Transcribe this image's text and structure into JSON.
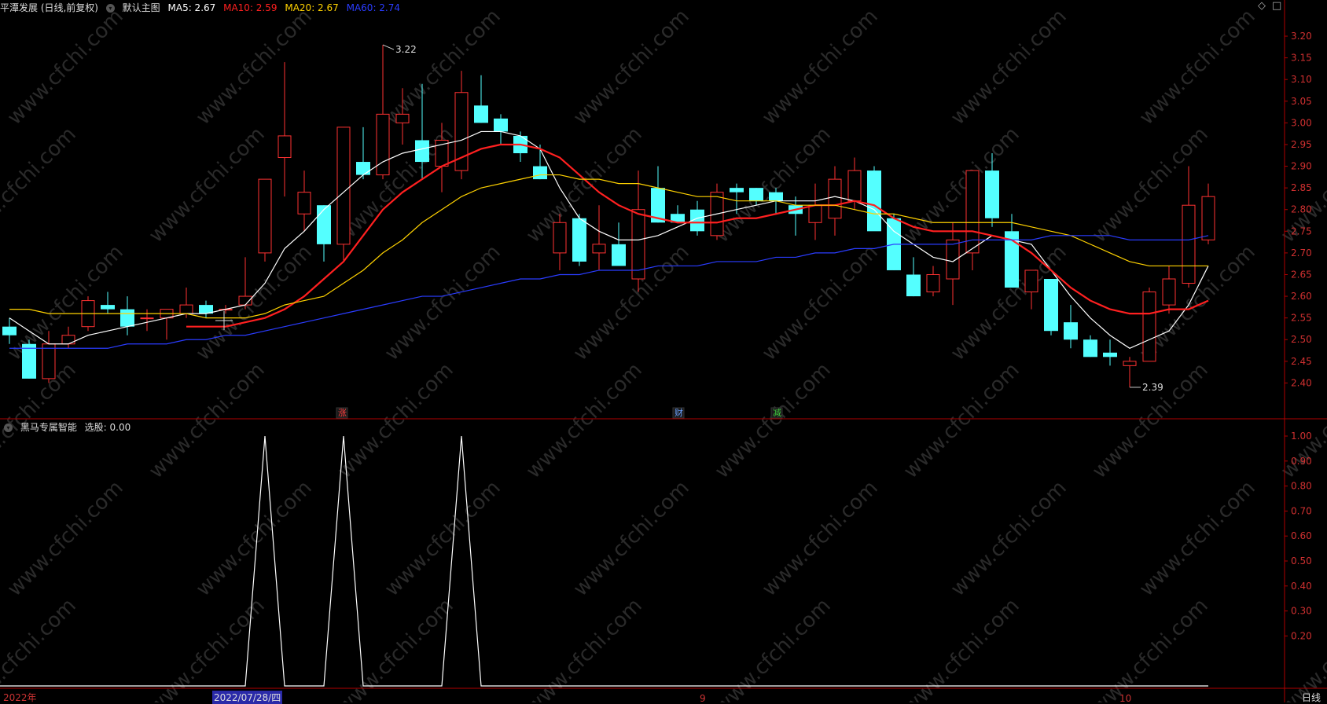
{
  "header": {
    "stock_label": "平潭发展 (日线,前复权)",
    "main_chart_label": "默认主图",
    "ma_items": [
      {
        "label": "MA5: 2.67",
        "color": "#ffffff"
      },
      {
        "label": "MA10: 2.59",
        "color": "#ff2020"
      },
      {
        "label": "MA20: 2.67",
        "color": "#ffd200"
      },
      {
        "label": "MA60: 2.74",
        "color": "#2a3cff"
      }
    ]
  },
  "subchart": {
    "label": "黑马专属智能",
    "value_label": "选股: 0.00"
  },
  "period_label": "日线",
  "x_labels": [
    "2022年",
    "2022/07/28/四",
    "9",
    "10"
  ],
  "markers": {
    "high": "3.22",
    "low": "2.39",
    "tags": [
      "涨",
      "财",
      "减"
    ]
  },
  "watermark": "www.cfchi.com",
  "chart_data": {
    "type": "candlestick",
    "price_axis": {
      "min": 2.35,
      "max": 3.22,
      "ticks": [
        "3.20",
        "3.15",
        "3.10",
        "3.05",
        "3.00",
        "2.95",
        "2.90",
        "2.85",
        "2.80",
        "2.75",
        "2.70",
        "2.65",
        "2.60",
        "2.55",
        "2.50",
        "2.45",
        "2.40"
      ]
    },
    "indicator_axis": {
      "min": 0,
      "max": 1.0,
      "ticks": [
        "1.00",
        "0.90",
        "0.80",
        "0.70",
        "0.60",
        "0.50",
        "0.40",
        "0.30",
        "0.20"
      ]
    },
    "colors": {
      "up": "#ff3232",
      "down": "#54ffff",
      "axis": "#b00000",
      "tick_text": "#d03030"
    },
    "candles": [
      [
        2.53,
        2.55,
        2.49,
        2.51
      ],
      [
        2.49,
        2.5,
        2.41,
        2.41
      ],
      [
        2.41,
        2.52,
        2.4,
        2.49
      ],
      [
        2.49,
        2.53,
        2.48,
        2.51
      ],
      [
        2.53,
        2.6,
        2.52,
        2.59
      ],
      [
        2.58,
        2.61,
        2.56,
        2.57
      ],
      [
        2.57,
        2.6,
        2.51,
        2.53
      ],
      [
        2.55,
        2.57,
        2.52,
        2.55
      ],
      [
        2.55,
        2.57,
        2.5,
        2.57
      ],
      [
        2.56,
        2.62,
        2.55,
        2.58
      ],
      [
        2.58,
        2.59,
        2.55,
        2.56
      ],
      [
        2.57,
        2.58,
        2.56,
        2.57
      ],
      [
        2.58,
        2.69,
        2.57,
        2.6
      ],
      [
        2.7,
        2.87,
        2.68,
        2.87
      ],
      [
        2.92,
        3.14,
        2.83,
        2.97
      ],
      [
        2.79,
        2.89,
        2.75,
        2.84
      ],
      [
        2.81,
        2.81,
        2.68,
        2.72
      ],
      [
        2.72,
        2.99,
        2.68,
        2.99
      ],
      [
        2.91,
        2.99,
        2.87,
        2.88
      ],
      [
        2.88,
        3.18,
        2.87,
        3.02
      ],
      [
        3.0,
        3.08,
        2.95,
        3.02
      ],
      [
        2.96,
        3.09,
        2.87,
        2.91
      ],
      [
        2.9,
        3.0,
        2.84,
        2.96
      ],
      [
        2.89,
        3.12,
        2.87,
        3.07
      ],
      [
        3.04,
        3.11,
        3.0,
        3.0
      ],
      [
        3.01,
        3.02,
        2.95,
        2.98
      ],
      [
        2.97,
        2.98,
        2.91,
        2.93
      ],
      [
        2.9,
        2.95,
        2.87,
        2.87
      ],
      [
        2.7,
        2.79,
        2.66,
        2.77
      ],
      [
        2.78,
        2.79,
        2.67,
        2.68
      ],
      [
        2.7,
        2.81,
        2.66,
        2.72
      ],
      [
        2.72,
        2.77,
        2.68,
        2.67
      ],
      [
        2.64,
        2.89,
        2.61,
        2.8
      ],
      [
        2.85,
        2.9,
        2.77,
        2.77
      ],
      [
        2.79,
        2.81,
        2.77,
        2.77
      ],
      [
        2.8,
        2.82,
        2.74,
        2.75
      ],
      [
        2.74,
        2.86,
        2.73,
        2.84
      ],
      [
        2.85,
        2.86,
        2.79,
        2.84
      ],
      [
        2.85,
        2.85,
        2.81,
        2.82
      ],
      [
        2.84,
        2.85,
        2.79,
        2.82
      ],
      [
        2.81,
        2.83,
        2.74,
        2.79
      ],
      [
        2.77,
        2.86,
        2.73,
        2.81
      ],
      [
        2.78,
        2.9,
        2.74,
        2.87
      ],
      [
        2.82,
        2.92,
        2.8,
        2.89
      ],
      [
        2.89,
        2.9,
        2.8,
        2.75
      ],
      [
        2.78,
        2.79,
        2.66,
        2.66
      ],
      [
        2.65,
        2.69,
        2.6,
        2.6
      ],
      [
        2.61,
        2.67,
        2.6,
        2.65
      ],
      [
        2.64,
        2.77,
        2.58,
        2.73
      ],
      [
        2.7,
        2.89,
        2.66,
        2.89
      ],
      [
        2.89,
        2.93,
        2.76,
        2.78
      ],
      [
        2.75,
        2.79,
        2.62,
        2.62
      ],
      [
        2.61,
        2.66,
        2.57,
        2.66
      ],
      [
        2.64,
        2.64,
        2.51,
        2.52
      ],
      [
        2.54,
        2.58,
        2.48,
        2.5
      ],
      [
        2.5,
        2.51,
        2.46,
        2.46
      ],
      [
        2.47,
        2.5,
        2.44,
        2.46
      ],
      [
        2.44,
        2.46,
        2.39,
        2.45
      ],
      [
        2.45,
        2.62,
        2.45,
        2.61
      ],
      [
        2.58,
        2.67,
        2.56,
        2.64
      ],
      [
        2.63,
        2.9,
        2.62,
        2.81
      ],
      [
        2.73,
        2.86,
        2.72,
        2.83
      ]
    ],
    "series": [
      {
        "name": "MA5",
        "color": "#ffffff",
        "values": [
          2.55,
          2.52,
          2.49,
          2.49,
          2.51,
          2.52,
          2.53,
          2.54,
          2.55,
          2.56,
          2.56,
          2.57,
          2.58,
          2.63,
          2.71,
          2.75,
          2.8,
          2.84,
          2.88,
          2.91,
          2.93,
          2.94,
          2.95,
          2.96,
          2.98,
          2.98,
          2.97,
          2.94,
          2.85,
          2.78,
          2.75,
          2.73,
          2.73,
          2.74,
          2.76,
          2.78,
          2.79,
          2.8,
          2.81,
          2.82,
          2.82,
          2.82,
          2.83,
          2.82,
          2.8,
          2.75,
          2.72,
          2.69,
          2.68,
          2.71,
          2.74,
          2.73,
          2.72,
          2.66,
          2.6,
          2.55,
          2.51,
          2.48,
          2.5,
          2.52,
          2.58,
          2.67
        ]
      },
      {
        "name": "MA10",
        "color": "#ff2020",
        "values": [
          null,
          null,
          null,
          null,
          null,
          null,
          null,
          null,
          null,
          2.53,
          2.53,
          2.53,
          2.54,
          2.55,
          2.57,
          2.6,
          2.64,
          2.68,
          2.74,
          2.8,
          2.84,
          2.87,
          2.9,
          2.92,
          2.94,
          2.95,
          2.95,
          2.94,
          2.92,
          2.88,
          2.84,
          2.81,
          2.79,
          2.78,
          2.77,
          2.77,
          2.77,
          2.78,
          2.78,
          2.79,
          2.8,
          2.81,
          2.81,
          2.82,
          2.81,
          2.78,
          2.76,
          2.75,
          2.75,
          2.75,
          2.74,
          2.73,
          2.7,
          2.66,
          2.62,
          2.59,
          2.57,
          2.56,
          2.56,
          2.57,
          2.57,
          2.59
        ]
      },
      {
        "name": "MA20",
        "color": "#ffd200",
        "values": [
          2.57,
          2.57,
          2.56,
          2.56,
          2.56,
          2.56,
          2.56,
          2.56,
          2.56,
          2.56,
          2.55,
          2.55,
          2.55,
          2.56,
          2.58,
          2.59,
          2.6,
          2.63,
          2.66,
          2.7,
          2.73,
          2.77,
          2.8,
          2.83,
          2.85,
          2.86,
          2.87,
          2.88,
          2.88,
          2.87,
          2.87,
          2.86,
          2.86,
          2.85,
          2.84,
          2.83,
          2.83,
          2.82,
          2.82,
          2.82,
          2.81,
          2.81,
          2.81,
          2.8,
          2.79,
          2.79,
          2.78,
          2.77,
          2.77,
          2.77,
          2.77,
          2.77,
          2.76,
          2.75,
          2.74,
          2.72,
          2.7,
          2.68,
          2.67,
          2.67,
          2.67,
          2.67
        ]
      },
      {
        "name": "MA60",
        "color": "#2a3cff",
        "values": [
          2.48,
          2.48,
          2.48,
          2.48,
          2.48,
          2.48,
          2.49,
          2.49,
          2.49,
          2.5,
          2.5,
          2.51,
          2.51,
          2.52,
          2.53,
          2.54,
          2.55,
          2.56,
          2.57,
          2.58,
          2.59,
          2.6,
          2.6,
          2.61,
          2.62,
          2.63,
          2.64,
          2.64,
          2.65,
          2.65,
          2.66,
          2.66,
          2.66,
          2.67,
          2.67,
          2.67,
          2.68,
          2.68,
          2.68,
          2.69,
          2.69,
          2.7,
          2.7,
          2.71,
          2.71,
          2.72,
          2.72,
          2.72,
          2.72,
          2.73,
          2.73,
          2.73,
          2.73,
          2.74,
          2.74,
          2.74,
          2.74,
          2.73,
          2.73,
          2.73,
          2.73,
          2.74
        ]
      }
    ],
    "signal": {
      "name": "选股",
      "color": "#ffffff",
      "peak_indices": [
        13,
        17,
        23
      ]
    }
  }
}
